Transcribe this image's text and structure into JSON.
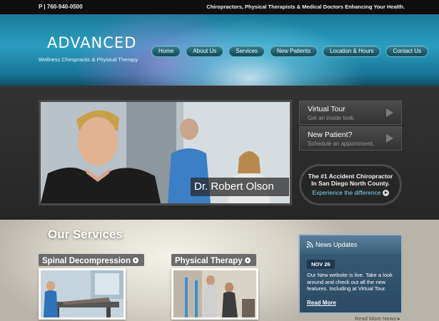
{
  "topbar": {
    "phone": "P | 760-940-0500",
    "tagline": "Chiropractors, Physical Therapists & Medical Doctors Enhancing Your Health."
  },
  "header": {
    "brand": "ADVANCED",
    "subtitle": "Wellness Chiropractic & Physical Therapy",
    "nav": [
      "Home",
      "About Us",
      "Services",
      "New Patients",
      "Location & Hours",
      "Contact Us"
    ]
  },
  "feature": {
    "photo_caption": "Dr. Robert Olson",
    "side_buttons": [
      {
        "title": "Virtual Tour",
        "subtitle": "Get an inside look."
      },
      {
        "title": "New Patient?",
        "subtitle": "Schedule an appointment."
      }
    ],
    "promo": {
      "line1": "The #1 Accident Chiropractor",
      "line2": "In San Diego North County.",
      "link": "Experience the difference"
    }
  },
  "services": {
    "title": "Our Services",
    "items": [
      {
        "label": "Spinal Decompression"
      },
      {
        "label": "Physical Therapy"
      }
    ]
  },
  "news": {
    "header": "News Updates",
    "date": "NOV 26",
    "body": "Our New website is live. Take a look around and check out all the new features. Including at Virtual Tour.",
    "more_link": "Read More",
    "read_more_news": "Read More News"
  },
  "colors": {
    "header_teal": "#2a9ec0",
    "nav_pill": "#164a59",
    "link_blue": "#7ed7f0",
    "news_blue": "#2b4a63"
  }
}
